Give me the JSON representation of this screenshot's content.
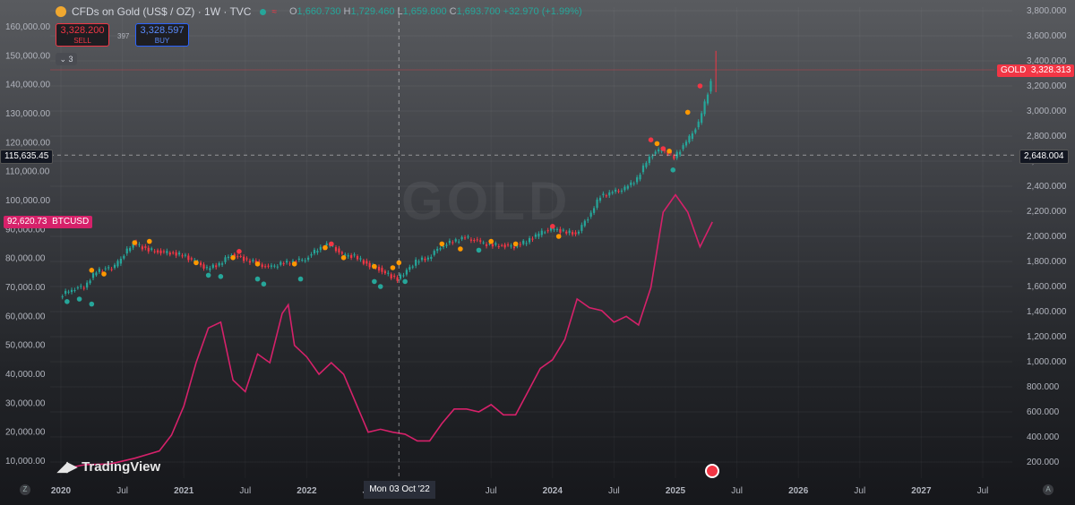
{
  "header": {
    "title": "CFDs on Gold (US$ / OZ) · 1W · TVC",
    "ohlc_label_o": "O",
    "ohlc_o": "1,660.730",
    "ohlc_label_h": "H",
    "ohlc_h": "1,729.460",
    "ohlc_label_l": "L",
    "ohlc_l": "1,659.800",
    "ohlc_label_c": "C",
    "ohlc_c": "1,693.700",
    "ohlc_change": "+32.970 (+1.99%)"
  },
  "trade": {
    "sell_price": "3,328.200",
    "sell_label": "SELL",
    "spread": "397",
    "buy_price": "3,328.597",
    "buy_label": "BUY"
  },
  "collapse_badge": "3",
  "labels": {
    "gold_symbol": "GOLD",
    "gold_price": "3,328.313",
    "crosshair_right": "2,648.004",
    "crosshair_left": "115,635.45",
    "btc_price": "92,620.73",
    "btc_symbol": "BTCUSD",
    "crosshair_time": "Mon 03 Oct '22"
  },
  "branding": {
    "name": "TradingView"
  },
  "colors": {
    "up": "#26a69a",
    "down": "#f23645",
    "btc": "#d6216a",
    "marker_orange": "#ff9800",
    "marker_red": "#f23645",
    "marker_teal": "#26a69a"
  },
  "chart_data": {
    "type": "line",
    "time_axis": {
      "ticks": [
        "2020",
        "Jul",
        "2021",
        "Jul",
        "2022",
        "Jul",
        "Mon 03 Oct '22",
        "Jul",
        "2024",
        "Jul",
        "2025",
        "Jul",
        "2026",
        "Jul",
        "2027",
        "Jul"
      ],
      "range": [
        "2020-01",
        "2027-12"
      ]
    },
    "right_axis": {
      "symbol": "GOLD",
      "ticks": [
        "3,800.000",
        "3,600.000",
        "3,400.000",
        "3,200.000",
        "3,000.000",
        "2,800.000",
        "2,600.000",
        "2,400.000",
        "2,200.000",
        "2,000.000",
        "1,800.000",
        "1,600.000",
        "1,400.000",
        "1,200.000",
        "1,000.000",
        "800.000",
        "600.000",
        "400.000",
        "200.000"
      ],
      "ylim": [
        200,
        3800
      ]
    },
    "left_axis": {
      "symbol": "BTCUSD",
      "ticks": [
        "160,000.00",
        "150,000.00",
        "140,000.00",
        "130,000.00",
        "120,000.00",
        "110,000.00",
        "100,000.00",
        "90,000.00",
        "80,000.00",
        "70,000.00",
        "60,000.00",
        "50,000.00",
        "40,000.00",
        "30,000.00",
        "20,000.00",
        "10,000.00"
      ],
      "ylim": [
        10000,
        160000
      ]
    },
    "series": [
      {
        "name": "GOLD",
        "x": [
          2020.0,
          2020.1,
          2020.2,
          2020.3,
          2020.45,
          2020.6,
          2020.7,
          2020.8,
          2020.9,
          2021.0,
          2021.1,
          2021.2,
          2021.3,
          2021.4,
          2021.5,
          2021.6,
          2021.7,
          2021.8,
          2021.9,
          2022.0,
          2022.1,
          2022.2,
          2022.3,
          2022.4,
          2022.5,
          2022.6,
          2022.7,
          2022.75,
          2022.8,
          2022.9,
          2023.0,
          2023.1,
          2023.2,
          2023.3,
          2023.4,
          2023.5,
          2023.6,
          2023.7,
          2023.8,
          2023.9,
          2024.0,
          2024.1,
          2024.2,
          2024.3,
          2024.4,
          2024.5,
          2024.6,
          2024.7,
          2024.8,
          2024.9,
          2025.0,
          2025.1,
          2025.2,
          2025.3
        ],
        "values": [
          1520,
          1580,
          1600,
          1720,
          1760,
          1950,
          1900,
          1880,
          1870,
          1850,
          1800,
          1740,
          1780,
          1860,
          1820,
          1790,
          1750,
          1780,
          1800,
          1820,
          1900,
          1940,
          1850,
          1840,
          1780,
          1740,
          1680,
          1660,
          1700,
          1800,
          1830,
          1920,
          1960,
          1990,
          1960,
          1930,
          1930,
          1920,
          1960,
          2020,
          2060,
          2040,
          2020,
          2150,
          2320,
          2350,
          2380,
          2460,
          2640,
          2700,
          2630,
          2750,
          2900,
          3230
        ]
      },
      {
        "name": "BTCUSD",
        "x": [
          2020.0,
          2020.2,
          2020.4,
          2020.6,
          2020.8,
          2020.9,
          2021.0,
          2021.1,
          2021.2,
          2021.3,
          2021.4,
          2021.5,
          2021.6,
          2021.7,
          2021.8,
          2021.85,
          2021.9,
          2022.0,
          2022.1,
          2022.2,
          2022.3,
          2022.4,
          2022.5,
          2022.6,
          2022.7,
          2022.8,
          2022.9,
          2023.0,
          2023.1,
          2023.2,
          2023.3,
          2023.4,
          2023.5,
          2023.6,
          2023.7,
          2023.8,
          2023.9,
          2024.0,
          2024.1,
          2024.2,
          2024.3,
          2024.4,
          2024.5,
          2024.6,
          2024.7,
          2024.8,
          2024.9,
          2025.0,
          2025.1,
          2025.2,
          2025.3
        ],
        "values": [
          7200,
          8800,
          9000,
          11000,
          13500,
          19000,
          29000,
          44000,
          56000,
          58000,
          38000,
          34000,
          47000,
          44000,
          61000,
          64000,
          50000,
          46000,
          40000,
          44000,
          40000,
          30000,
          20000,
          21000,
          20000,
          19300,
          17000,
          17000,
          23000,
          28000,
          28000,
          27000,
          29500,
          26000,
          26000,
          34000,
          42000,
          45000,
          52000,
          66000,
          63000,
          62000,
          58000,
          60000,
          57000,
          70000,
          96000,
          102000,
          96000,
          84000,
          92600
        ]
      }
    ],
    "markers": [
      {
        "color": "orange",
        "x": 2020.25,
        "y": 1730
      },
      {
        "color": "orange",
        "x": 2020.35,
        "y": 1700
      },
      {
        "color": "orange",
        "x": 2020.6,
        "y": 1950
      },
      {
        "color": "orange",
        "x": 2020.72,
        "y": 1960
      },
      {
        "color": "teal",
        "x": 2020.05,
        "y": 1480
      },
      {
        "color": "teal",
        "x": 2020.15,
        "y": 1500
      },
      {
        "color": "teal",
        "x": 2020.25,
        "y": 1460
      },
      {
        "color": "orange",
        "x": 2021.1,
        "y": 1790
      },
      {
        "color": "orange",
        "x": 2021.4,
        "y": 1830
      },
      {
        "color": "red",
        "x": 2021.45,
        "y": 1880
      },
      {
        "color": "orange",
        "x": 2021.6,
        "y": 1780
      },
      {
        "color": "teal",
        "x": 2021.2,
        "y": 1690
      },
      {
        "color": "teal",
        "x": 2021.3,
        "y": 1680
      },
      {
        "color": "teal",
        "x": 2021.6,
        "y": 1660
      },
      {
        "color": "teal",
        "x": 2021.65,
        "y": 1620
      },
      {
        "color": "orange",
        "x": 2021.9,
        "y": 1780
      },
      {
        "color": "teal",
        "x": 2021.95,
        "y": 1660
      },
      {
        "color": "orange",
        "x": 2022.15,
        "y": 1910
      },
      {
        "color": "red",
        "x": 2022.2,
        "y": 1940
      },
      {
        "color": "orange",
        "x": 2022.3,
        "y": 1830
      },
      {
        "color": "orange",
        "x": 2022.55,
        "y": 1760
      },
      {
        "color": "orange",
        "x": 2022.7,
        "y": 1750
      },
      {
        "color": "orange",
        "x": 2022.75,
        "y": 1790
      },
      {
        "color": "teal",
        "x": 2022.55,
        "y": 1640
      },
      {
        "color": "teal",
        "x": 2022.6,
        "y": 1600
      },
      {
        "color": "teal",
        "x": 2022.8,
        "y": 1640
      },
      {
        "color": "orange",
        "x": 2023.1,
        "y": 1940
      },
      {
        "color": "orange",
        "x": 2023.25,
        "y": 1900
      },
      {
        "color": "orange",
        "x": 2023.5,
        "y": 1960
      },
      {
        "color": "orange",
        "x": 2023.7,
        "y": 1940
      },
      {
        "color": "teal",
        "x": 2023.4,
        "y": 1890
      },
      {
        "color": "red",
        "x": 2024.0,
        "y": 2080
      },
      {
        "color": "orange",
        "x": 2024.05,
        "y": 2000
      },
      {
        "color": "red",
        "x": 2024.8,
        "y": 2770
      },
      {
        "color": "orange",
        "x": 2024.85,
        "y": 2740
      },
      {
        "color": "red",
        "x": 2024.9,
        "y": 2700
      },
      {
        "color": "orange",
        "x": 2024.95,
        "y": 2680
      },
      {
        "color": "teal",
        "x": 2024.98,
        "y": 2530
      },
      {
        "color": "orange",
        "x": 2025.1,
        "y": 2990
      },
      {
        "color": "red",
        "x": 2025.2,
        "y": 3200
      }
    ]
  }
}
